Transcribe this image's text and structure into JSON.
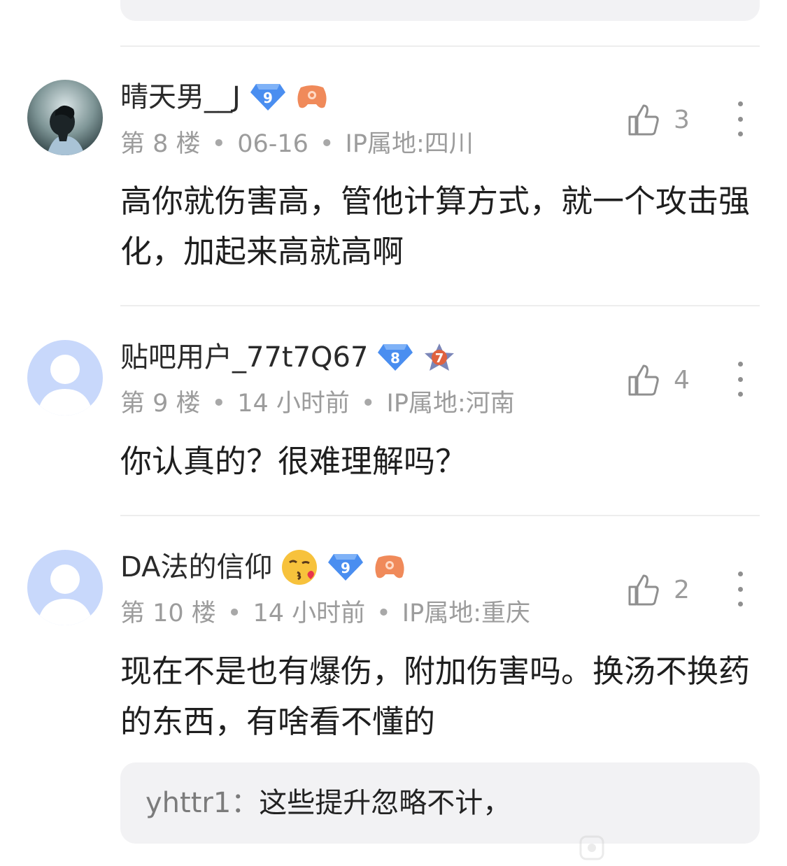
{
  "posts": [
    {
      "username": "晴天男__J",
      "level": "9",
      "floor": "第 8 楼",
      "time": "06-16",
      "ip": "IP属地:四川",
      "content": "高你就伤害高，管他计算方式，就一个攻击强化，加起来高就高啊",
      "likes": "3",
      "avatar_icon": "user-photo-avatar",
      "extra_badge_icon": "gamepad-icon"
    },
    {
      "username": "贴吧用户_77t7Q67",
      "level": "8",
      "floor": "第 9 楼",
      "time": "14 小时前",
      "ip": "IP属地:河南",
      "content": "你认真的？很难理解吗？",
      "likes": "4",
      "avatar_icon": "default-avatar",
      "extra_badge": "7",
      "extra_badge_icon": "star-badge-icon"
    },
    {
      "username": "DA法的信仰",
      "emoji": "😘",
      "level": "9",
      "floor": "第 10 楼",
      "time": "14 小时前",
      "ip": "IP属地:重庆",
      "content": "现在不是也有爆伤，附加伤害吗。换汤不换药的东西，有啥看不懂的",
      "likes": "2",
      "avatar_icon": "default-avatar",
      "extra_badge_icon": "gamepad-icon",
      "reply": {
        "author": "yhttr1",
        "separator": "：",
        "text": "这些提升忽略不计，"
      }
    }
  ],
  "colors": {
    "level_badge": "#4a8ef0",
    "gamepad": "#f08a5a",
    "meta_text": "#9c9c9c",
    "card_bg": "#f2f2f4"
  },
  "icons": {
    "like": "thumb-up-icon",
    "more": "more-vertical-icon"
  }
}
